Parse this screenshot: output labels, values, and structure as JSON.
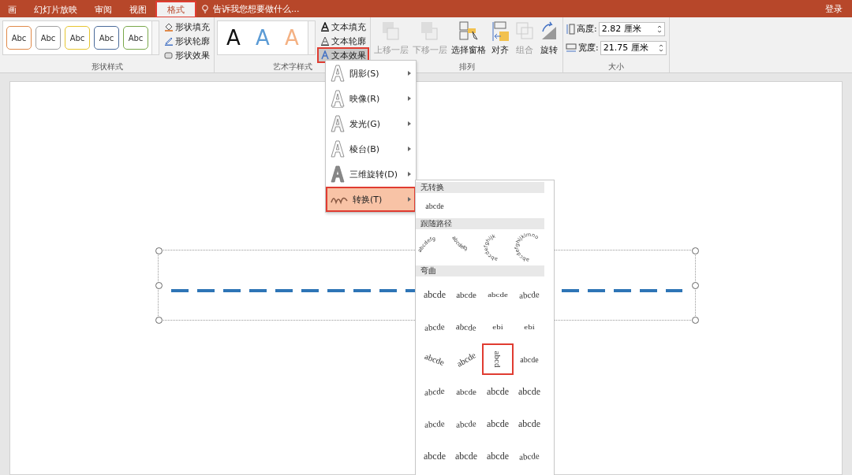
{
  "tabs": [
    {
      "label": "画",
      "selected": false
    },
    {
      "label": "幻灯片放映",
      "selected": false
    },
    {
      "label": "审阅",
      "selected": false
    },
    {
      "label": "视图",
      "selected": false
    },
    {
      "label": "格式",
      "selected": true
    }
  ],
  "tell_me": "告诉我您想要做什么...",
  "sign_in": "登录",
  "ribbon": {
    "shape_styles": {
      "label": "形状样式",
      "swatches": [
        {
          "text": "Abc",
          "color": "#e08a4a"
        },
        {
          "text": "Abc",
          "color": "#a0a0a0"
        },
        {
          "text": "Abc",
          "color": "#e6c530"
        },
        {
          "text": "Abc",
          "color": "#4a6b9a"
        },
        {
          "text": "Abc",
          "color": "#79a84a"
        }
      ],
      "commands": [
        {
          "label": "形状填充"
        },
        {
          "label": "形状轮廓"
        },
        {
          "label": "形状效果"
        }
      ]
    },
    "wordart_styles": {
      "label": "艺术字样式",
      "swatches": [
        {
          "text": "A",
          "color": "#111111"
        },
        {
          "text": "A",
          "color": "#5b9bd5"
        },
        {
          "text": "A",
          "color": "#f4b183"
        }
      ],
      "commands": [
        {
          "label": "文本填充",
          "selected": false
        },
        {
          "label": "文本轮廓",
          "selected": false
        },
        {
          "label": "文本效果",
          "selected": true
        }
      ]
    },
    "arrange": {
      "label": "排列",
      "buttons": [
        {
          "label": "上移一层",
          "disabled": true
        },
        {
          "label": "下移一层",
          "disabled": true
        },
        {
          "label": "选择窗格",
          "disabled": false
        },
        {
          "label": "对齐",
          "disabled": false
        },
        {
          "label": "组合",
          "disabled": true
        },
        {
          "label": "旋转",
          "disabled": false
        }
      ]
    },
    "size": {
      "label": "大小",
      "fields": [
        {
          "label": "高度:",
          "value": "2.82 厘米"
        },
        {
          "label": "宽度:",
          "value": "21.75 厘米"
        }
      ]
    }
  },
  "effects_menu": [
    {
      "label": "阴影(S)",
      "kind": "outline",
      "selected": false
    },
    {
      "label": "映像(R)",
      "kind": "reflection",
      "selected": false
    },
    {
      "label": "发光(G)",
      "kind": "glow",
      "selected": false
    },
    {
      "label": "棱台(B)",
      "kind": "outline",
      "selected": false
    },
    {
      "label": "三维旋转(D)",
      "kind": "solid",
      "selected": false
    },
    {
      "label": "转换(T)",
      "kind": "warp",
      "selected": true
    }
  ],
  "transform_gallery": [
    {
      "heading": "无转换",
      "kind": "none",
      "items": [
        {
          "text": "abcde",
          "kind": "tiny",
          "selected": false
        }
      ]
    },
    {
      "heading": "跟随路径",
      "kind": "path",
      "items": [
        {
          "text": "abcdefg",
          "kind": "arch-up",
          "selected": false
        },
        {
          "text": "abcdefg",
          "kind": "arch-down",
          "selected": false
        },
        {
          "text": "abcdefghijk",
          "kind": "circle",
          "selected": false
        },
        {
          "text": "abcdefghijklmno",
          "kind": "button",
          "selected": false
        }
      ]
    },
    {
      "heading": "弯曲",
      "kind": "warp",
      "items": [
        {
          "text": "abcde",
          "kind": "plain",
          "selected": false
        },
        {
          "text": "abcde",
          "kind": "small",
          "selected": false
        },
        {
          "text": "abcde",
          "kind": "squash",
          "selected": false
        },
        {
          "text": "abcde",
          "kind": "rise",
          "selected": false
        },
        {
          "text": "abcde",
          "kind": "rise",
          "selected": false
        },
        {
          "text": "abcde",
          "kind": "fall",
          "selected": false
        },
        {
          "text": "ebi",
          "kind": "squash",
          "selected": false
        },
        {
          "text": "ebi",
          "kind": "squash",
          "selected": false
        },
        {
          "text": "abcde",
          "kind": "tilt-right",
          "selected": false
        },
        {
          "text": "abcde",
          "kind": "tilt-left",
          "selected": false
        },
        {
          "text": "abcd",
          "kind": "ring",
          "selected": true
        },
        {
          "text": "abcde",
          "kind": "tiny",
          "selected": false
        },
        {
          "text": "abcde",
          "kind": "grow",
          "selected": false
        },
        {
          "text": "abcde",
          "kind": "small",
          "selected": false
        },
        {
          "text": "abcde",
          "kind": "plain",
          "selected": false
        },
        {
          "text": "abcde",
          "kind": "plain",
          "selected": false
        },
        {
          "text": "abcde",
          "kind": "rise",
          "selected": false
        },
        {
          "text": "abcde",
          "kind": "rise",
          "selected": false
        },
        {
          "text": "abcde",
          "kind": "plain",
          "selected": false
        },
        {
          "text": "abcde",
          "kind": "plain",
          "selected": false
        },
        {
          "text": "abcde",
          "kind": "plain",
          "selected": false
        },
        {
          "text": "abcde",
          "kind": "plain",
          "selected": false
        },
        {
          "text": "abcde",
          "kind": "plain",
          "selected": false
        },
        {
          "text": "abcde",
          "kind": "rise",
          "selected": false
        }
      ]
    }
  ]
}
